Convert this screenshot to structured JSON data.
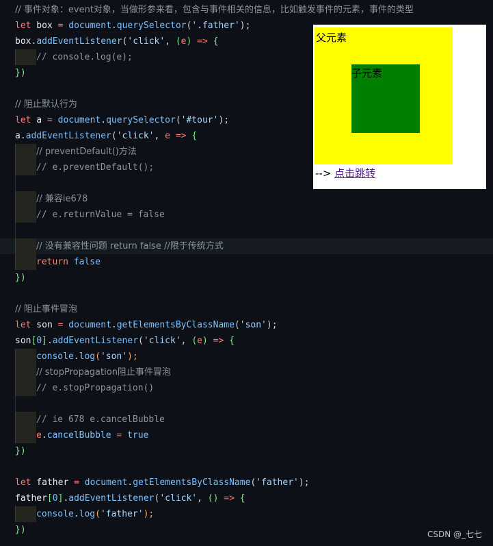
{
  "code": {
    "l1_comment": "// 事件对象：event对象，当做形参来看，包含与事件相关的信息，比如触发事件的元素，事件的类型",
    "l2": {
      "kw": "let",
      "var": " box ",
      "op": "= ",
      "obj": "document",
      "dot": ".",
      "fn": "querySelector",
      "open": "(",
      "str": "'.father'",
      "close": ");"
    },
    "l3": {
      "var": "box",
      "dot": ".",
      "fn": "addEventListener",
      "open": "(",
      "str": "'click'",
      "comma": ", ",
      "p_open": "(",
      "param": "e",
      "p_close": ")",
      "arrow": " => ",
      "brace": "{"
    },
    "l4_comment": "// console.log(e);",
    "l5": "})",
    "l7_comment": "// 阻止默认行为",
    "l8": {
      "kw": "let",
      "var": " a ",
      "op": "= ",
      "obj": "document",
      "dot": ".",
      "fn": "querySelector",
      "open": "(",
      "str": "'#tour'",
      "close": ");"
    },
    "l9": {
      "var": "a",
      "dot": ".",
      "fn": "addEventListener",
      "open": "(",
      "str": "'click'",
      "comma": ", ",
      "param": "e",
      "arrow": " => ",
      "brace": "{"
    },
    "l10_comment": "// preventDefault()方法",
    "l11_comment": "// e.preventDefault();",
    "l13_comment": "// 兼容ie678",
    "l14_comment": "// e.returnValue = false",
    "l16_comment": "// 没有兼容性问题 return false //限于传统方式",
    "l17": {
      "kw": "return",
      "val": " false"
    },
    "l18": "})",
    "l20_comment": "// 阻止事件冒泡",
    "l21": {
      "kw": "let",
      "var": " son ",
      "op": "= ",
      "obj": "document",
      "dot": ".",
      "fn": "getElementsByClassName",
      "open": "(",
      "str": "'son'",
      "close": ");"
    },
    "l22": {
      "var": "son",
      "idx_open": "[",
      "idx": "0",
      "idx_close": "]",
      "dot": ".",
      "fn": "addEventListener",
      "open": "(",
      "str": "'click'",
      "comma": ", ",
      "p_open": "(",
      "param": "e",
      "p_close": ")",
      "arrow": " => ",
      "brace": "{"
    },
    "l23": {
      "obj": "console",
      "dot": ".",
      "fn": "log",
      "open": "(",
      "str": "'son'",
      "close": ");"
    },
    "l24_comment": "// stopPropagation阻止事件冒泡",
    "l25_comment": "// e.stopPropagation()",
    "l27_comment": "// ie 678 e.cancelBubble",
    "l28": {
      "var": "e",
      "dot": ".",
      "prop": "cancelBubble",
      "op": " = ",
      "val": "true"
    },
    "l29": "})",
    "l31": {
      "kw": "let",
      "var": " father ",
      "op": "= ",
      "obj": "document",
      "dot": ".",
      "fn": "getElementsByClassName",
      "open": "(",
      "str": "'father'",
      "close": ");"
    },
    "l32": {
      "var": "father",
      "idx_open": "[",
      "idx": "0",
      "idx_close": "]",
      "dot": ".",
      "fn": "addEventListener",
      "open": "(",
      "str": "'click'",
      "comma": ", ",
      "p": "()",
      "arrow": " => ",
      "brace": "{"
    },
    "l33": {
      "obj": "console",
      "dot": ".",
      "fn": "log",
      "open": "(",
      "str": "'father'",
      "close": ");"
    },
    "l34": "})"
  },
  "preview": {
    "father_label": "父元素",
    "son_label": "子元素",
    "arrow_text": "--> ",
    "link_text": "点击跳转"
  },
  "watermark": "CSDN @_七七",
  "colors": {
    "background": "#0d1117",
    "keyword": "#ff7b72",
    "function": "#79c0ff",
    "string": "#a5d6ff",
    "comment": "#8b949e",
    "father_box": "#ffff00",
    "son_box": "#008000"
  }
}
